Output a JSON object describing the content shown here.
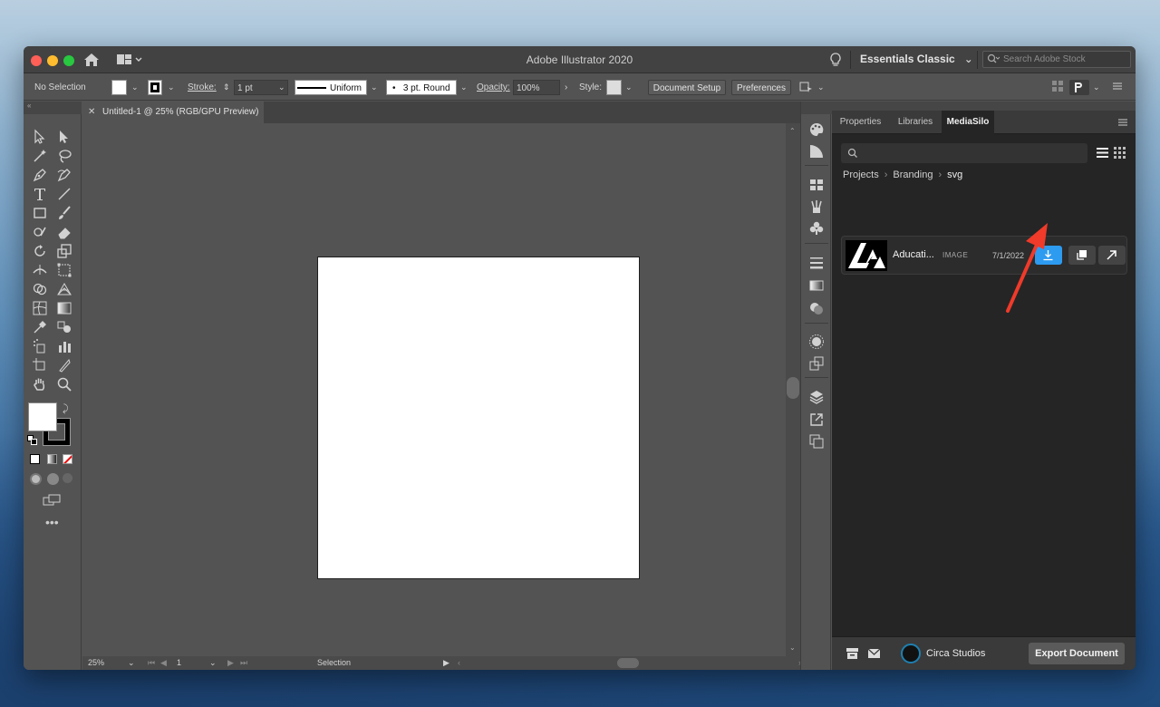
{
  "app": {
    "title": "Adobe Illustrator 2020",
    "workspace": "Essentials Classic",
    "stock_search_placeholder": "Search Adobe Stock"
  },
  "controlbar": {
    "selection": "No Selection",
    "stroke_label": "Stroke:",
    "stroke_value": "1 pt",
    "profile": "Uniform",
    "brush": "3 pt. Round",
    "opacity_label": "Opacity:",
    "opacity_value": "100%",
    "style_label": "Style:",
    "doc_setup": "Document Setup",
    "preferences": "Preferences"
  },
  "document": {
    "tab": "Untitled-1 @ 25% (RGB/GPU Preview)",
    "zoom": "25%",
    "artboard": "1",
    "status": "Selection"
  },
  "panel": {
    "tabs": [
      "Properties",
      "Libraries",
      "MediaSilo"
    ],
    "active_tab": "MediaSilo",
    "breadcrumbs": [
      "Projects",
      "Branding",
      "svg"
    ],
    "asset": {
      "name": "Aducati...",
      "type": "IMAGE",
      "date": "7/1/2022"
    },
    "footer": {
      "company": "Circa Studios",
      "export": "Export Document"
    }
  },
  "colors": {
    "accent_blue": "#2d9bf0",
    "arrow_red": "#f03a2a"
  }
}
